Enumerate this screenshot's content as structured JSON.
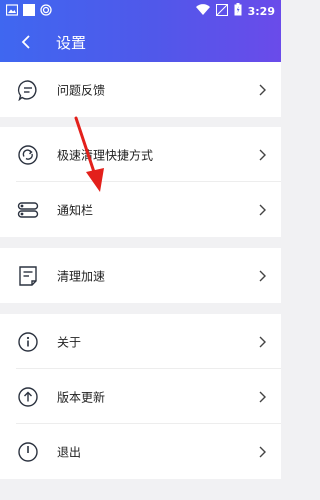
{
  "status_bar": {
    "time": "3:29",
    "icons": [
      "gallery-icon",
      "square-icon",
      "spiral-icon",
      "wifi-icon",
      "signal-off-icon",
      "battery-icon"
    ]
  },
  "app_bar": {
    "title": "设置",
    "back_icon": "back-arrow-icon"
  },
  "groups": [
    {
      "items": [
        {
          "label": "问题反馈",
          "icon": "feedback-chat-icon"
        }
      ]
    },
    {
      "items": [
        {
          "label": "极速清理快捷方式",
          "icon": "refresh-shortcut-icon"
        },
        {
          "label": "通知栏",
          "icon": "notification-bar-icon"
        }
      ]
    },
    {
      "items": [
        {
          "label": "清理加速",
          "icon": "document-clean-icon"
        }
      ]
    },
    {
      "items": [
        {
          "label": "关于",
          "icon": "info-icon"
        },
        {
          "label": "版本更新",
          "icon": "upload-arrow-icon"
        },
        {
          "label": "退出",
          "icon": "power-icon"
        }
      ]
    }
  ],
  "colors": {
    "header_gradient_start": "#3f67f0",
    "header_gradient_end": "#6a4bea",
    "icon_stroke": "#2c3340",
    "annotation_arrow": "#e3201b",
    "background": "#f1f1f3"
  }
}
